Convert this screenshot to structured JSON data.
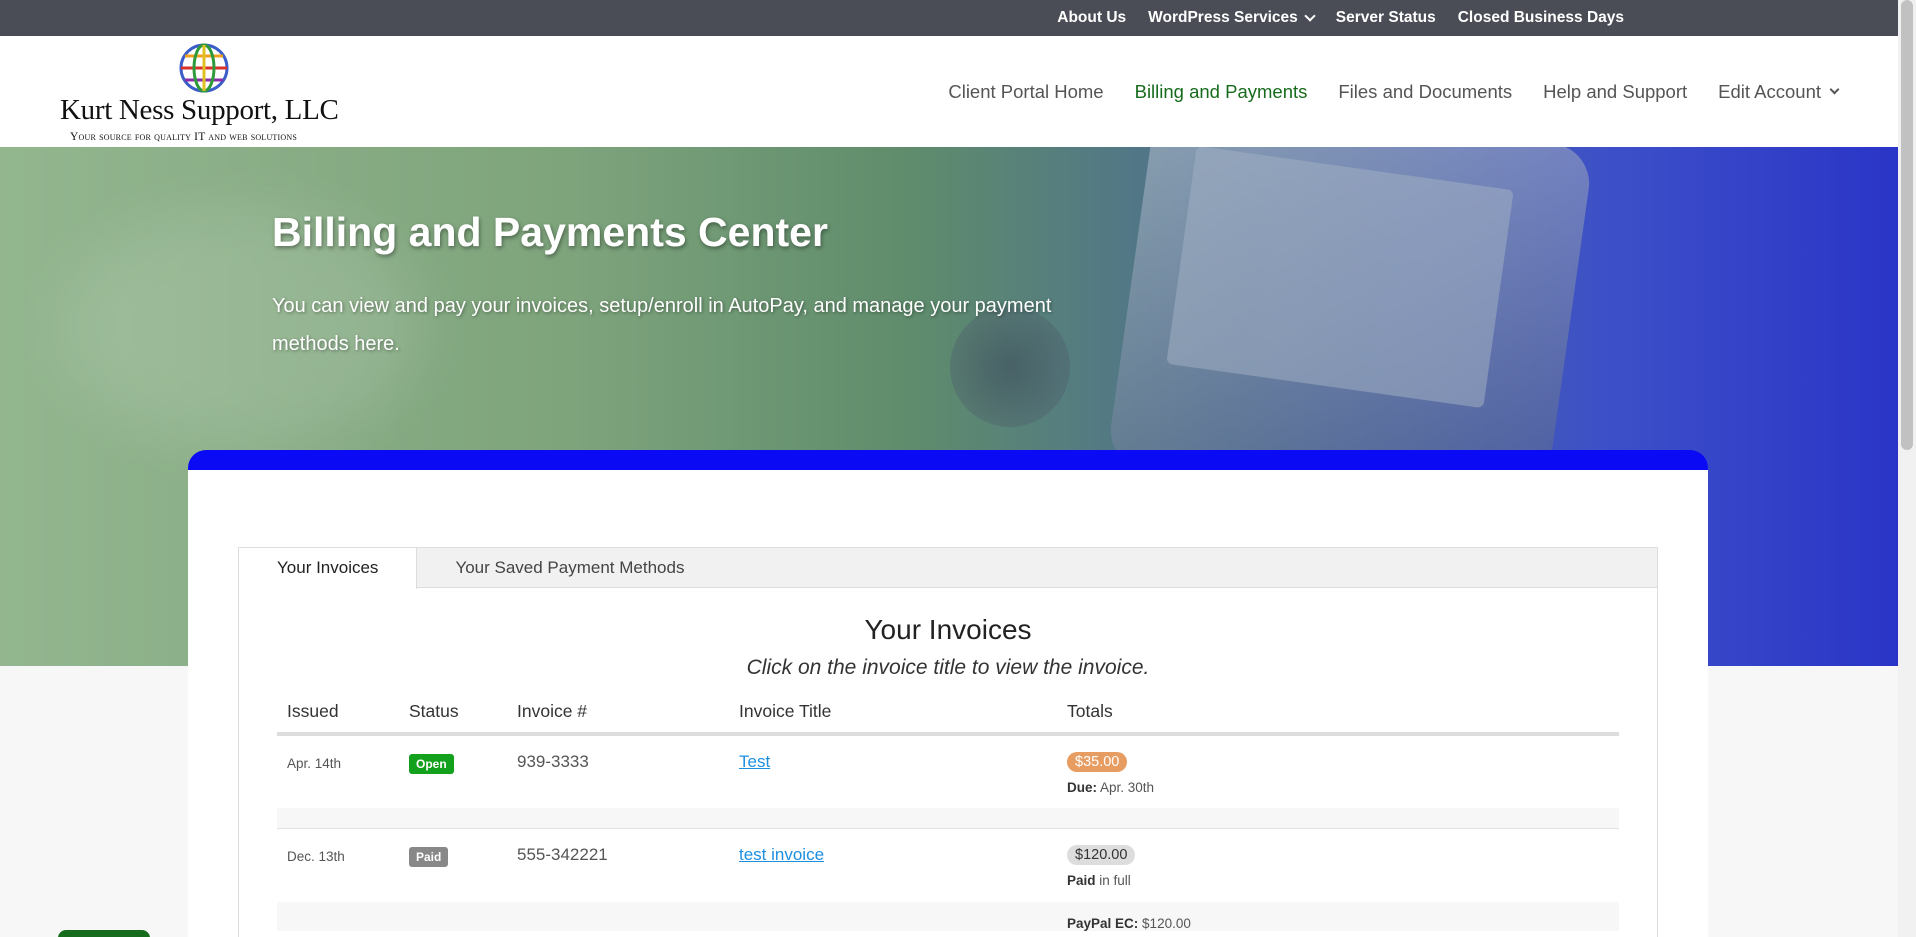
{
  "topbar": {
    "links": [
      "About Us",
      "WordPress Services",
      "Server Status",
      "Closed Business Days"
    ]
  },
  "logo": {
    "name": "Kurt Ness Support, LLC",
    "tagline": "Your source for quality IT and web solutions"
  },
  "nav": {
    "items": [
      "Client Portal Home",
      "Billing and Payments",
      "Files and Documents",
      "Help and Support",
      "Edit Account"
    ],
    "active": "Billing and Payments"
  },
  "hero": {
    "title": "Billing and Payments Center",
    "text": "You can view and pay your invoices, setup/enroll in AutoPay, and manage your payment methods here."
  },
  "tabs": [
    "Your Invoices",
    "Your Saved Payment Methods"
  ],
  "invoices": {
    "title": "Your Invoices",
    "subtitle": "Click on the invoice title to view the invoice.",
    "columns": [
      "Issued",
      "Status",
      "Invoice #",
      "Invoice Title",
      "Totals"
    ],
    "rows": [
      {
        "issued": "Apr. 14th",
        "status": "Open",
        "number": "939-3333",
        "title": "Test",
        "total": "$35.00",
        "meta_label": "Due:",
        "meta_value": " Apr. 30th"
      },
      {
        "issued": "Dec. 13th",
        "status": "Paid",
        "number": "555-342221",
        "title": "test invoice",
        "total": "$120.00",
        "meta_label": "Paid",
        "meta_value": " in full",
        "payment_label": "PayPal EC:",
        "payment_value": " $120.00"
      }
    ]
  },
  "colors": {
    "topbar": "#4a4d55",
    "accent_green": "#176b1c",
    "card_border": "#0a0af5",
    "open_badge": "#12a01d",
    "due_pill": "#e79d61"
  }
}
